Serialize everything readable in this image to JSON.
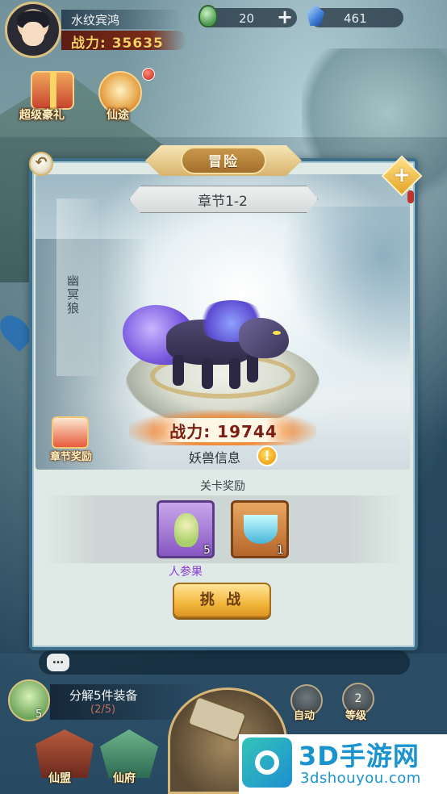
{
  "player": {
    "name": "水纹宾鸿",
    "power": "战力: 35635"
  },
  "resources": {
    "jade": "20",
    "gems": "461",
    "add_symbol": "+"
  },
  "top_icons": {
    "gift_label": "超级豪礼",
    "xiantu_label": "仙途"
  },
  "modal": {
    "title": "冒险",
    "back_symbol": "↶",
    "corner_symbol": "+",
    "chapter": "章节1-2",
    "monster_name": "幽冥狼",
    "monster_power": "战力: 19744",
    "info_label": "妖兽信息",
    "info_symbol": "!",
    "chapter_reward_label": "章节奖励",
    "rewards_title": "关卡奖励",
    "rewards": [
      {
        "name": "人参果",
        "count": "5",
        "rarity_color": "#8a3ad6"
      },
      {
        "name": "",
        "count": "1",
        "rarity_color": "#b6662b"
      }
    ],
    "challenge_label": "挑 战"
  },
  "bottom": {
    "chat_icon": "…",
    "quest_text": "分解5件装备",
    "quest_progress": "(2/5)",
    "quest_count": "5",
    "auto_label": "自动",
    "level_label": "等级",
    "level_value": "2",
    "alliance_label": "仙盟",
    "mansion_label": "仙府"
  },
  "watermark": {
    "title": "3D手游网",
    "url": "3dshouyou.com"
  },
  "colors": {
    "power_text": "#f6cf63",
    "modal_border": "#3d6f8a",
    "button_gold": "#f2b73c",
    "item_name_purple": "#8a3ad6"
  }
}
